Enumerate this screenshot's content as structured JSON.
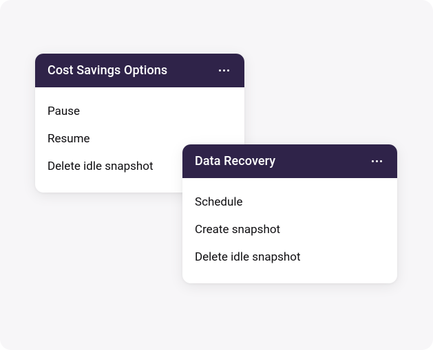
{
  "cards": [
    {
      "title": "Cost Savings Options",
      "items": [
        "Pause",
        "Resume",
        "Delete idle snapshot"
      ]
    },
    {
      "title": "Data Recovery",
      "items": [
        "Schedule",
        "Create snapshot",
        "Delete idle snapshot"
      ]
    }
  ]
}
